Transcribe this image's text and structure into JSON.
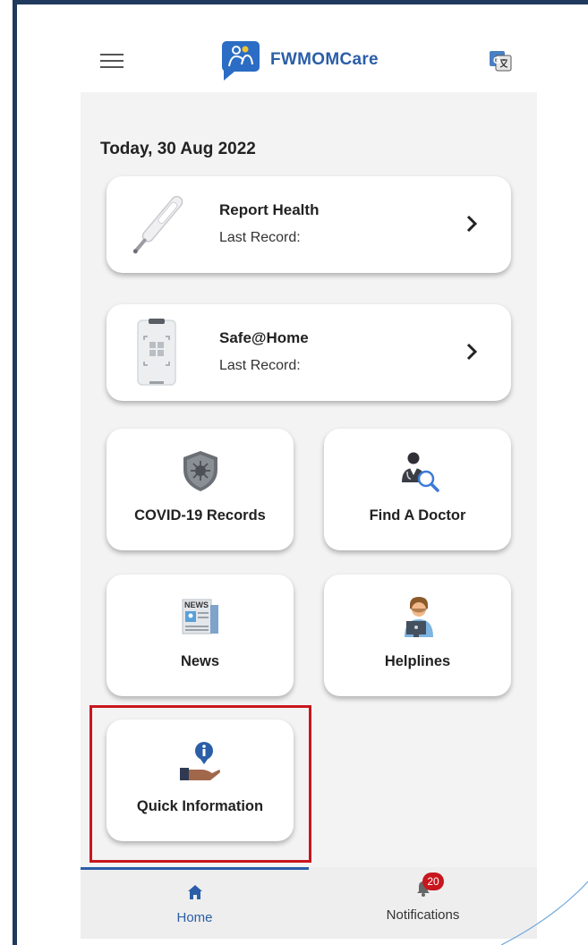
{
  "header": {
    "app_name": "FWMOMCare",
    "menu_icon": "hamburger-menu-icon",
    "translate_icon": "translate-icon",
    "brand_color": "#2b5ea7"
  },
  "main": {
    "date_label": "Today, 30 Aug 2022",
    "cards": [
      {
        "title": "Report Health",
        "subtitle": "Last Record:",
        "icon": "thermometer-icon"
      },
      {
        "title": "Safe@Home",
        "subtitle": "Last Record:",
        "icon": "safe-home-device-icon"
      }
    ],
    "tiles": [
      {
        "label": "COVID-19 Records",
        "icon": "virus-shield-icon"
      },
      {
        "label": "Find A Doctor",
        "icon": "doctor-search-icon"
      },
      {
        "label": "News",
        "icon": "newspaper-icon"
      },
      {
        "label": "Helplines",
        "icon": "helpline-agent-icon"
      },
      {
        "label": "Quick Information",
        "icon": "info-hand-icon"
      }
    ]
  },
  "bottom_nav": {
    "home_label": "Home",
    "notifications_label": "Notifications",
    "notification_count": "20",
    "active_tab": "Home",
    "badge_color": "#c8161e"
  },
  "highlight_color": "#c8161e"
}
